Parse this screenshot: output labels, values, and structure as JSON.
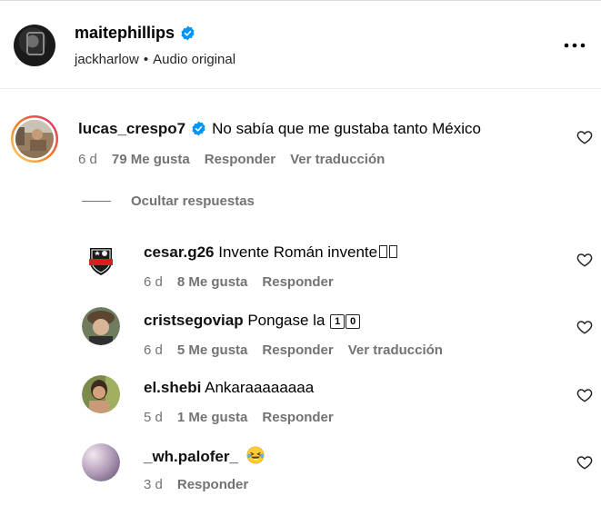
{
  "header": {
    "username": "maitephillips",
    "audio_artist": "jackharlow",
    "separator": "•",
    "audio_label": "Audio original"
  },
  "colors": {
    "verified": "#0095f6",
    "meta_text": "#737373",
    "story_ring_start": "#feda75",
    "story_ring_end": "#d62976"
  },
  "icons": {
    "more": "more-horizontal-icon",
    "like": "heart-outline-icon",
    "verified": "verified-badge-icon"
  },
  "main_comment": {
    "username": "lucas_crespo7",
    "text": "No sabía que me gustaba tanto México",
    "time": "6 d",
    "likes": "79 Me gusta",
    "reply": "Responder",
    "translate": "Ver traducción"
  },
  "hide_replies_label": "Ocultar respuestas",
  "replies": [
    {
      "username": "cesar.g26",
      "text": "Invente Román invente",
      "time": "6 d",
      "likes": "8 Me gusta",
      "reply": "Responder"
    },
    {
      "username": "cristsegoviap",
      "text": "Pongase la",
      "keycaps": [
        "1",
        "0"
      ],
      "time": "6 d",
      "likes": "5 Me gusta",
      "reply": "Responder",
      "translate": "Ver traducción"
    },
    {
      "username": "el.shebi",
      "text": "Ankaraaaaaaaa",
      "time": "5 d",
      "likes": "1 Me gusta",
      "reply": "Responder"
    },
    {
      "username": "_wh.palofer_",
      "text": "",
      "emoji": "laughing-tears-emoji",
      "time": "3 d",
      "reply": "Responder"
    }
  ]
}
